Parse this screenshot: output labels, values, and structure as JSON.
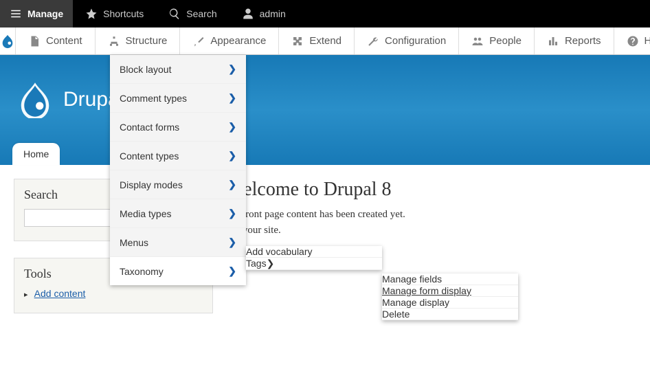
{
  "topbar": {
    "manage": "Manage",
    "shortcuts": "Shortcuts",
    "search": "Search",
    "user": "admin"
  },
  "adminbar": {
    "content": "Content",
    "structure": "Structure",
    "appearance": "Appearance",
    "extend": "Extend",
    "configuration": "Configuration",
    "people": "People",
    "reports": "Reports",
    "help": "Help"
  },
  "site": {
    "name": "Drupal 8",
    "home_tab": "Home"
  },
  "left": {
    "search_title": "Search",
    "tools_title": "Tools",
    "add_content": "Add content"
  },
  "content": {
    "title": "Welcome to Drupal 8",
    "line1": "No front page content has been created yet.",
    "line2_suffix": "ing your site."
  },
  "structure_menu": {
    "items": [
      "Block layout",
      "Comment types",
      "Contact forms",
      "Content types",
      "Display modes",
      "Media types",
      "Menus",
      "Taxonomy"
    ]
  },
  "taxonomy_menu": {
    "add_vocab": "Add vocabulary",
    "tags": "Tags"
  },
  "tags_menu": {
    "manage_fields": "Manage fields",
    "manage_form_display": "Manage form display",
    "manage_display": "Manage display",
    "delete": "Delete"
  }
}
